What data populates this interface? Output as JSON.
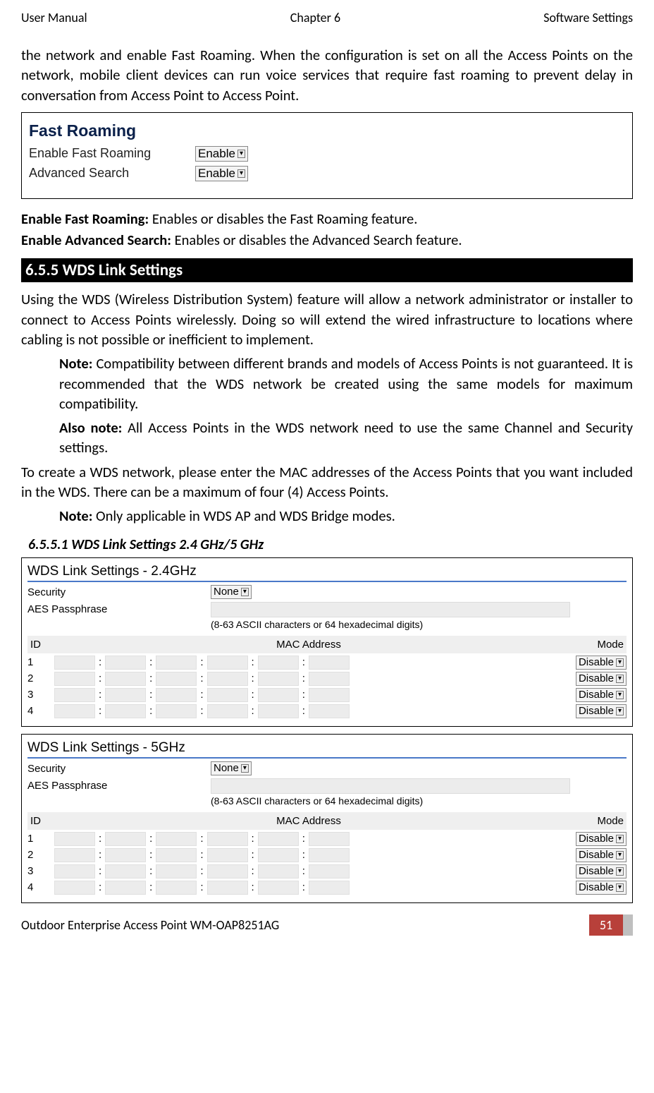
{
  "header": {
    "left": "User Manual",
    "center": "Chapter 6",
    "right": "Software Settings"
  },
  "intro_para": "the network and enable Fast Roaming. When the configuration is set on all the Access Points on the network, mobile client devices can run voice services that require fast roaming to prevent delay in conversation from Access Point to Access Point.",
  "fast_roaming": {
    "title": "Fast Roaming",
    "enable_label": "Enable Fast Roaming",
    "enable_value": "Enable",
    "advanced_label": "Advanced Search",
    "advanced_value": "Enable"
  },
  "desc": {
    "efr_b": "Enable Fast Roaming:",
    "efr_t": " Enables or disables the Fast Roaming feature.",
    "eas_b": "Enable Advanced Search:",
    "eas_t": " Enables or disables the Advanced Search feature."
  },
  "section_655": "6.5.5 WDS Link Settings",
  "wds_intro": "Using the WDS (Wireless Distribution System) feature will allow a network administrator or installer to connect to Access Points wirelessly. Doing so will extend the wired infrastructure to locations where cabling is not possible or inefficient to implement.",
  "note1_b": "Note:",
  "note1_t": " Compatibility between different brands and models of Access Points is not guaranteed. It is recommended that the WDS network be created using the same models for maximum compatibility.",
  "note2_b": "Also note:",
  "note2_t": " All Access Points in the WDS network need to use the same Channel and Security settings.",
  "wds_para2": "To create a WDS network, please enter the MAC addresses of the Access Points that you want included in the WDS. There can be a maximum of four (4) Access Points.",
  "note3_b": "Note:",
  "note3_t": " Only applicable in WDS AP and WDS Bridge modes.",
  "sub_65551": "6.5.5.1 WDS Link Settings 2.4 GHz/5 GHz",
  "wds_panel": {
    "title24": "WDS Link Settings - 2.4GHz",
    "title5": "WDS Link Settings - 5GHz",
    "security_label": "Security",
    "security_value": "None",
    "aes_label": "AES Passphrase",
    "aes_hint": "(8-63 ASCII characters or 64 hexadecimal digits)",
    "col_id": "ID",
    "col_mac": "MAC Address",
    "col_mode": "Mode",
    "mode_value": "Disable",
    "ids": [
      "1",
      "2",
      "3",
      "4"
    ]
  },
  "footer": {
    "product": "Outdoor Enterprise Access Point WM-OAP8251AG",
    "page": "51"
  }
}
